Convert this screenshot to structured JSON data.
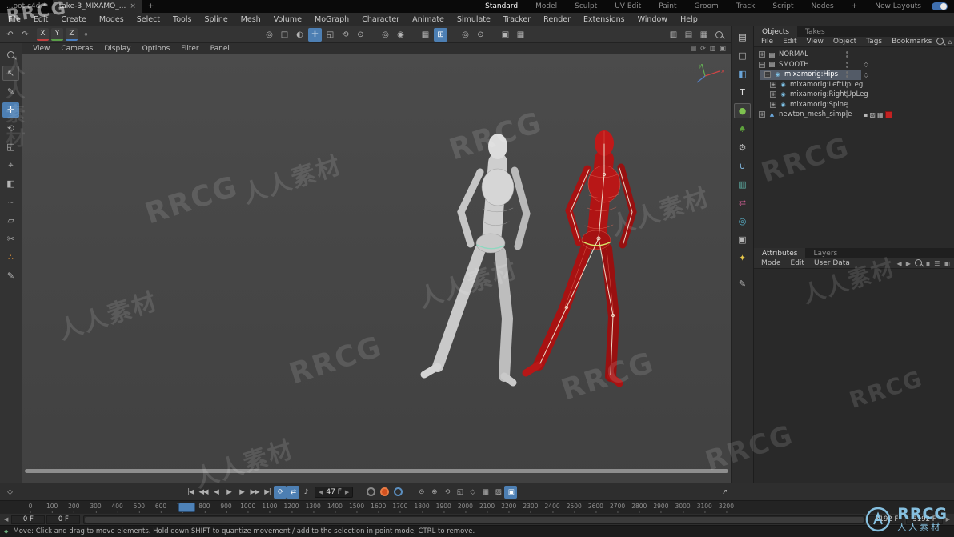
{
  "titlebar": {
    "tabs": [
      {
        "label": "...oot.c4d *"
      },
      {
        "label": "take-3_MIXAMO_...",
        "close": "×"
      }
    ],
    "new_tab": "+",
    "layouts": [
      {
        "label": "Standard",
        "active": true
      },
      {
        "label": "Model"
      },
      {
        "label": "Sculpt"
      },
      {
        "label": "UV Edit"
      },
      {
        "label": "Paint"
      },
      {
        "label": "Groom"
      },
      {
        "label": "Track"
      },
      {
        "label": "Script"
      },
      {
        "label": "Nodes"
      },
      {
        "label": "+"
      },
      {
        "label": "New Layouts"
      }
    ]
  },
  "menubar": {
    "items": [
      "File",
      "Edit",
      "Create",
      "Modes",
      "Select",
      "Tools",
      "Spline",
      "Mesh",
      "Volume",
      "MoGraph",
      "Character",
      "Animate",
      "Simulate",
      "Tracker",
      "Render",
      "Extensions",
      "Window",
      "Help"
    ]
  },
  "toolbar": {
    "axes": [
      "X",
      "Y",
      "Z"
    ]
  },
  "viewport": {
    "menu": [
      "View",
      "Cameras",
      "Display",
      "Options",
      "Filter",
      "Panel"
    ],
    "gizmo": {
      "x": "x",
      "y": "y"
    }
  },
  "objects_panel": {
    "tabs": [
      {
        "label": "Objects",
        "active": true
      },
      {
        "label": "Takes"
      }
    ],
    "menu": [
      "File",
      "Edit",
      "View",
      "Object",
      "Tags",
      "Bookmarks"
    ],
    "tree": [
      {
        "label": "NORMAL"
      },
      {
        "label": "SMOOTH"
      },
      {
        "label": "mixamorig:Hips"
      },
      {
        "label": "mixamorig:LeftUpLeg"
      },
      {
        "label": "mixamorig:RightUpLeg"
      },
      {
        "label": "mixamorig:Spine"
      },
      {
        "label": "newton_mesh_simple"
      }
    ]
  },
  "attributes_panel": {
    "tabs": [
      {
        "label": "Attributes",
        "active": true
      },
      {
        "label": "Layers"
      }
    ],
    "menu": [
      "Mode",
      "Edit",
      "User Data"
    ]
  },
  "timeline": {
    "current_frame": "47 F",
    "ruler": {
      "start": 0,
      "end": 3200,
      "step": 100
    },
    "range": {
      "start_a": "0 F",
      "start_b": "0 F",
      "end_a": "3192 F",
      "end_b": "3192 F"
    }
  },
  "statusbar": {
    "text": "Move: Click and drag to move elements. Hold down SHIFT to quantize movement / add to the selection in point mode, CTRL to remove."
  },
  "watermark": {
    "brand": "RRCG",
    "cn": "人人素材"
  },
  "icons": {
    "undo": "↶",
    "redo": "↷",
    "coord": "⌖",
    "cursor": "↖",
    "pen": "✎",
    "move": "✛",
    "rotate": "⟲",
    "scale": "◱",
    "live_select": "◎",
    "half": "◐",
    "grid": "▦",
    "snap": "⊞",
    "target": "⊙",
    "plus": "✚",
    "circle": "◎",
    "dot_circle": "◉",
    "render": "▣",
    "render_settings": "▦",
    "layout_a": "▥",
    "layout_b": "▤",
    "layout_c": "▦",
    "book": "▤",
    "square": "□",
    "cube": "◧",
    "t": "T",
    "sphere": "●",
    "tree": "♠",
    "gear": "⚙",
    "magnet": "∪",
    "clipboard": "▥",
    "arrows": "⇄",
    "globe": "◎",
    "camera": "▣",
    "bulb": "✦",
    "pencil": "✎",
    "knife": "✂",
    "spline": "~",
    "dots3": "∴",
    "shape": "▱",
    "expander_plus": "+",
    "expander_minus": "−",
    "doc": "▤",
    "joint": "◉",
    "mesh": "▲",
    "diamond": "◇",
    "lock": "▪",
    "tag_a": "▨",
    "tag_b": "▦",
    "key": "◇",
    "to_start": "|◀",
    "prev_key": "◀◀",
    "prev": "◀",
    "play": "▶",
    "next": "▶",
    "next_key": "▶▶",
    "to_end": "▶|",
    "loop": "⟳",
    "cycle": "⇄",
    "speaker": "♪",
    "left": "◀",
    "right": "▶",
    "clock": "⊙",
    "pos_key": "⊕",
    "rot_key": "⟲",
    "scale_key": "◱",
    "param_key": "◇",
    "fcurve": "↗",
    "sheet": "▦",
    "autokey": "▣",
    "home": "⌂",
    "filter": "▼",
    "burger": "☰",
    "panel": "▣",
    "status": "◆"
  }
}
